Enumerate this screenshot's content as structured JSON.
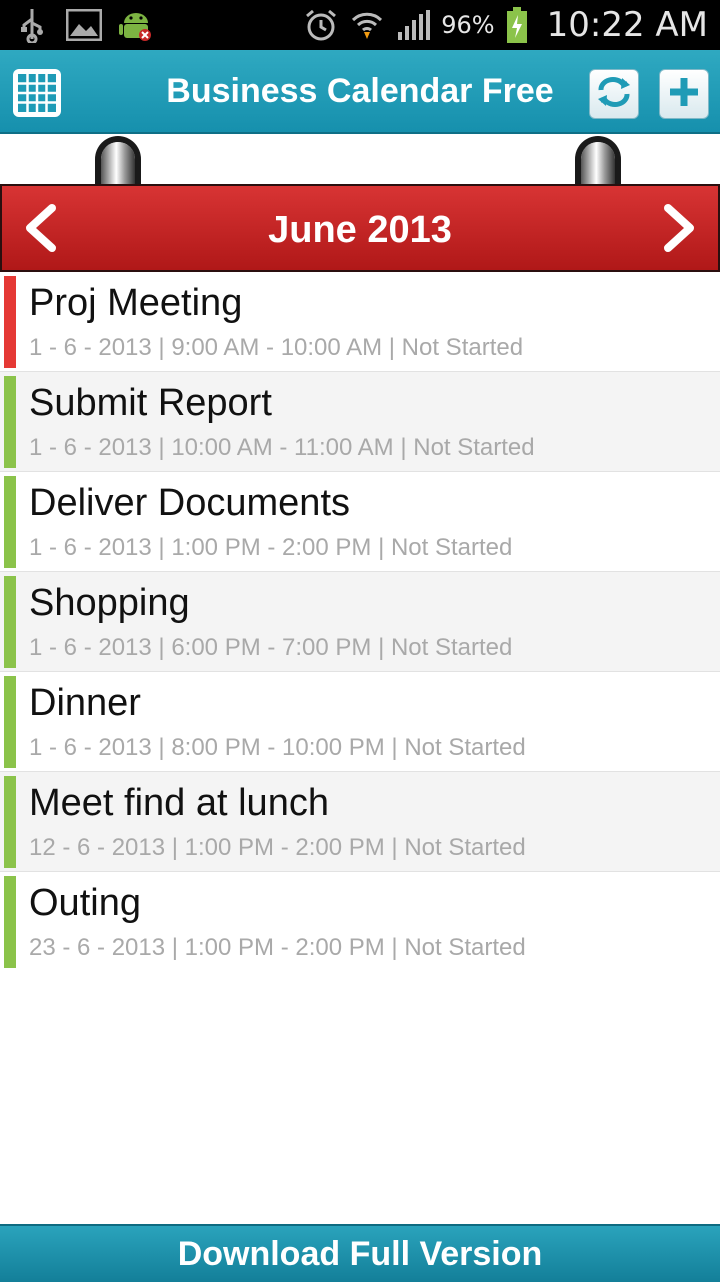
{
  "status_bar": {
    "battery": "96%",
    "time": "10:22 AM"
  },
  "app_bar": {
    "title": "Business Calendar Free"
  },
  "calendar": {
    "month_label": "June 2013"
  },
  "events": [
    {
      "title": "Proj Meeting",
      "meta": "1 - 6 - 2013 | 9:00 AM - 10:00 AM | Not Started",
      "color": "#e53935"
    },
    {
      "title": "Submit Report",
      "meta": "1 - 6 - 2013 | 10:00 AM - 11:00 AM | Not Started",
      "color": "#8bc34a"
    },
    {
      "title": "Deliver Documents",
      "meta": "1 - 6 - 2013 | 1:00 PM - 2:00 PM | Not Started",
      "color": "#8bc34a"
    },
    {
      "title": "Shopping",
      "meta": "1 - 6 - 2013 | 6:00 PM - 7:00 PM | Not Started",
      "color": "#8bc34a"
    },
    {
      "title": "Dinner",
      "meta": "1 - 6 - 2013 | 8:00 PM - 10:00 PM | Not Started",
      "color": "#8bc34a"
    },
    {
      "title": "Meet find at lunch",
      "meta": "12 - 6 - 2013 | 1:00 PM - 2:00 PM | Not Started",
      "color": "#8bc34a"
    },
    {
      "title": "Outing",
      "meta": "23 - 6 - 2013 | 1:00 PM - 2:00 PM | Not Started",
      "color": "#8bc34a"
    }
  ],
  "footer": {
    "label": "Download Full Version"
  },
  "colors": {
    "accent": "#1f9bb6",
    "month_bar": "#c62828"
  }
}
